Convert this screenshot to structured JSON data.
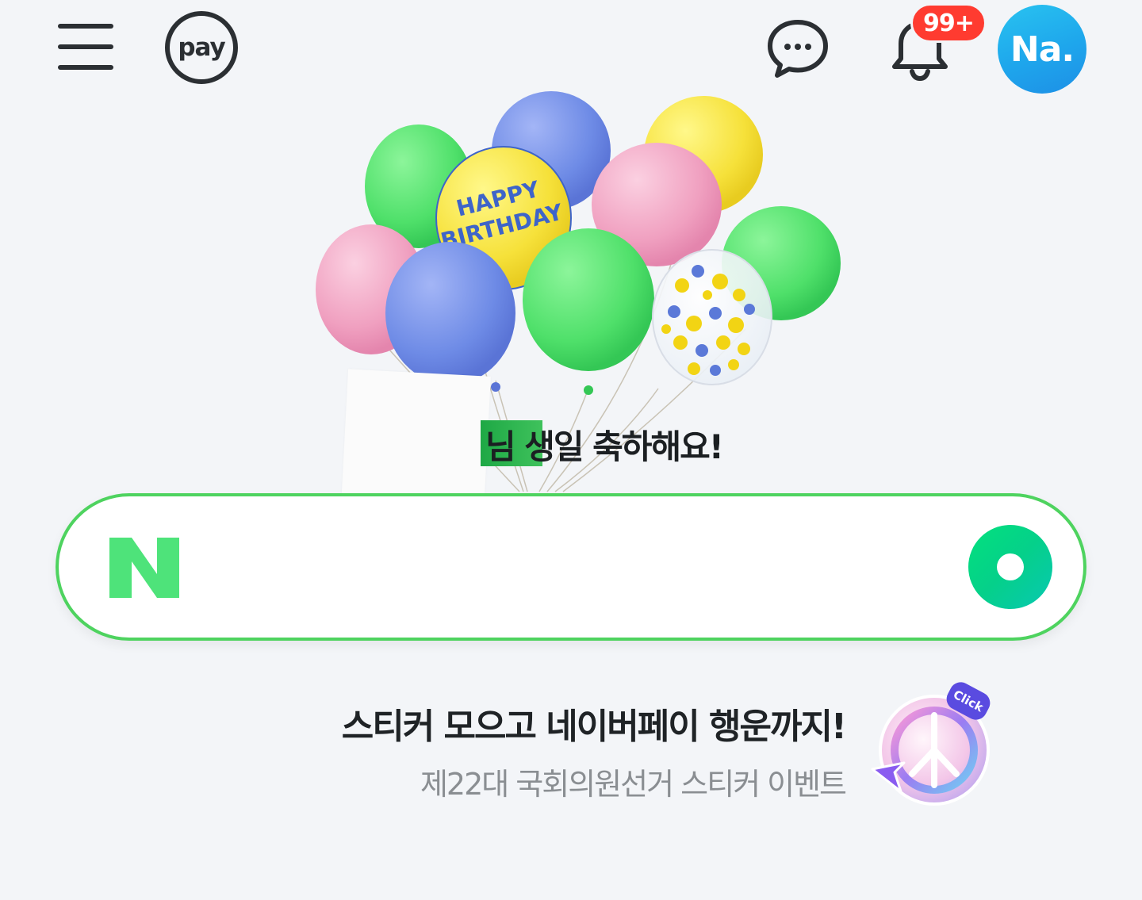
{
  "header": {
    "menu_icon": "hamburger-menu-icon",
    "pay_label": "pay",
    "talk_icon": "chat-bubble-icon",
    "bell_icon": "bell-icon",
    "notification_count": "99+",
    "avatar_label": "Na."
  },
  "hero": {
    "balloon_text": "HAPPY BIRTHDAY",
    "greeting_suffix": "님 생일 축하해요!"
  },
  "search": {
    "logo": "N",
    "placeholder": "",
    "button_icon": "search-circle-icon"
  },
  "promo": {
    "title": "스티커 모으고 네이버페이 행운까지!",
    "subtitle": "제22대 국회의원선거 스티커 이벤트",
    "click_tag": "Click"
  },
  "colors": {
    "brand_green": "#03c75a",
    "badge_red": "#ff3b30",
    "avatar_blue": "#1ea6ec"
  }
}
